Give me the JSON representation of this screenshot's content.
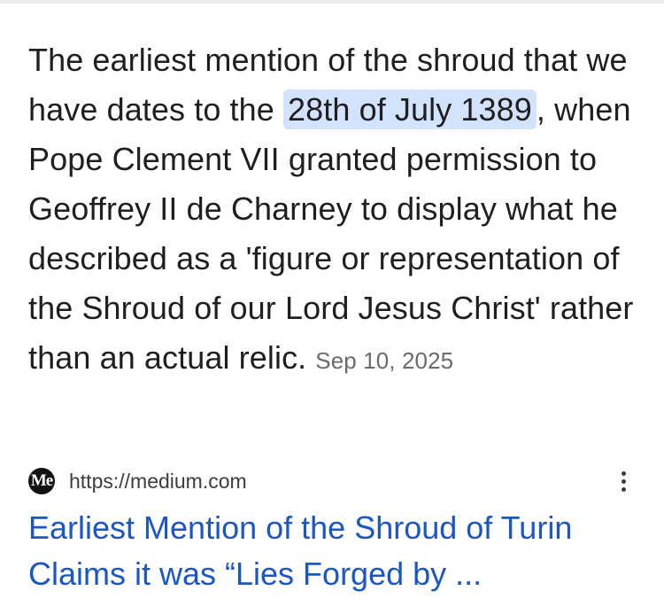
{
  "snippet": {
    "text_part1": "The earliest mention of the shroud that we have dates to the ",
    "highlight": "28th of July 1389",
    "text_part2": ", when Pope Clement VII granted permission to Geoffrey II de Charney to display what he described as a 'figure or representation of the Shroud of our Lord Jesus Christ' rather than an actual relic.",
    "date": "Sep 10, 2025"
  },
  "source": {
    "favicon_text": "Me",
    "favicon_icon": "medium-logo-icon",
    "url": "https://medium.com",
    "more_icon": "more-vert-icon"
  },
  "result": {
    "title": "Earliest Mention of the Shroud of Turin Claims it was “Lies Forged by ..."
  },
  "colors": {
    "highlight_bg": "#d3e3fd",
    "link": "#1a56c8",
    "text": "#1f1f1f",
    "muted": "#6b6b6b"
  }
}
